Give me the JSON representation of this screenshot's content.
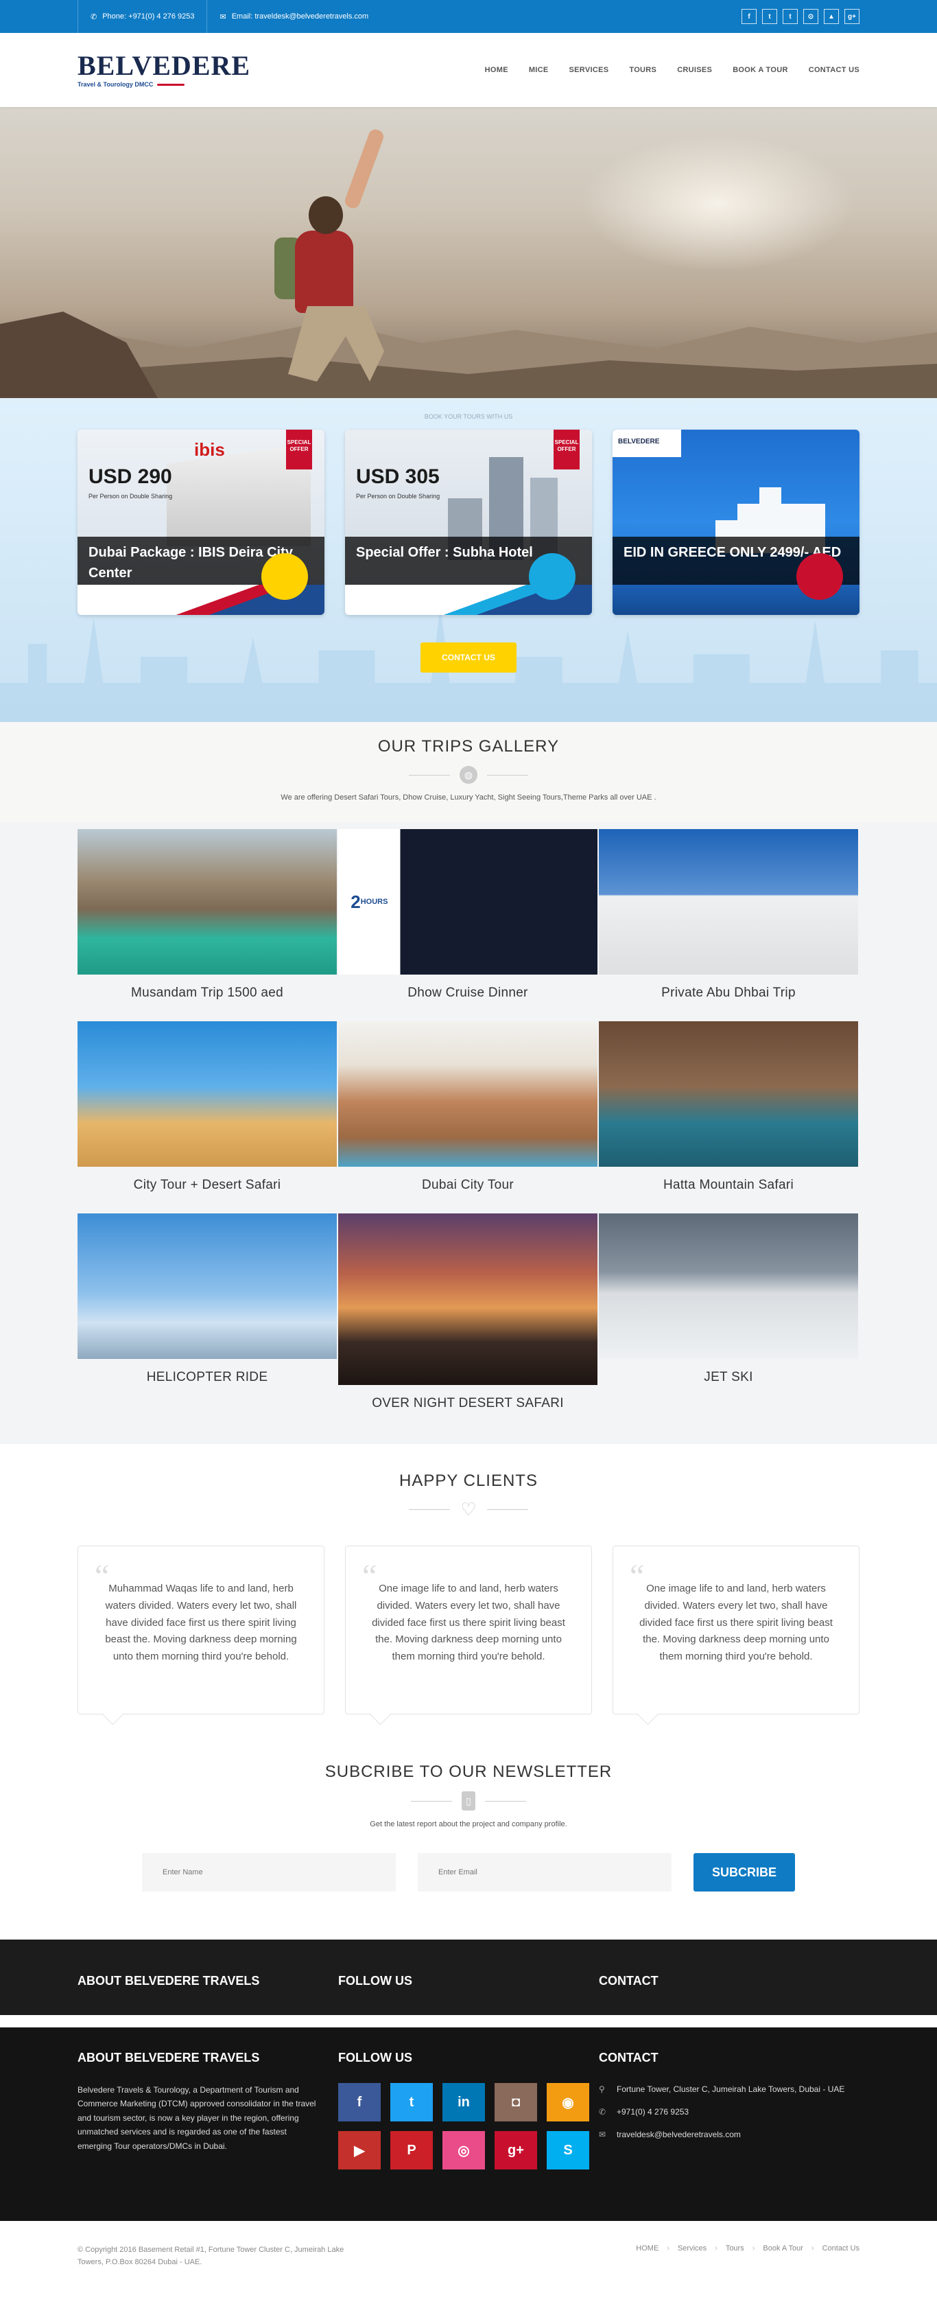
{
  "topbar": {
    "phone": "Phone: +971(0) 4 276 9253",
    "email": "Email: traveldesk@belvederetravels.com",
    "socials": [
      "f",
      "t",
      "t",
      "⊙",
      "▲",
      "g+"
    ]
  },
  "header": {
    "logo_name": "BELVEDERE",
    "logo_tag": "Travel & Tourology DMCC",
    "nav": [
      "HOME",
      "MICE",
      "SERVICES",
      "TOURS",
      "CRUISES",
      "BOOK A TOUR",
      "CONTACT US"
    ]
  },
  "offers": {
    "small_title": "BOOK YOUR TOURS WITH US",
    "cards": [
      {
        "price": "USD 290",
        "sub": "Per Person on Double Sharing",
        "badge": "SPECIAL OFFER",
        "caption": "Dubai Package : IBIS Deira City Center",
        "dot": "#ffd200"
      },
      {
        "price": "USD 305",
        "sub": "Per Person on Double Sharing",
        "badge": "SPECIAL OFFER",
        "caption": "Special Offer : Subha Hotel",
        "dot": "#19a9e1"
      },
      {
        "price": "",
        "sub": "",
        "badge": "",
        "caption": "EID IN GREECE ONLY 2499/- AED",
        "dot": "#c8102e"
      }
    ],
    "button": "CONTACT US"
  },
  "gallery": {
    "title": "OUR TRIPS GALLERY",
    "subtitle": "We are offering Desert Safari Tours, Dhow Cruise, Luxury Yacht, Sight Seeing Tours,Theme Parks all over UAE .",
    "items": [
      {
        "label": "Musandam Trip 1500 aed"
      },
      {
        "label": "Dhow Cruise Dinner"
      },
      {
        "label": "Private Abu Dhbai Trip"
      },
      {
        "label": "City Tour + Desert Safari"
      },
      {
        "label": "Dubai City Tour"
      },
      {
        "label": "Hatta Mountain Safari"
      },
      {
        "label": "HELICOPTER RIDE"
      },
      {
        "label": "OVER NIGHT DESERT SAFARI"
      },
      {
        "label": "JET SKI"
      }
    ]
  },
  "clients": {
    "title": "HAPPY CLIENTS",
    "testimonials": [
      "Muhammad Waqas life to and land, herb waters divided. Waters every let two, shall have divided face first us there spirit living beast the. Moving darkness deep morning unto them morning third you're behold.",
      "One image life to and land, herb waters divided. Waters every let two, shall have divided face first us there spirit living beast the. Moving darkness deep morning unto them morning third you're behold.",
      "One image life to and land, herb waters divided. Waters every let two, shall have divided face first us there spirit living beast the. Moving darkness deep morning unto them morning third you're behold."
    ]
  },
  "newsletter": {
    "title": "SUBCRIBE TO OUR NEWSLETTER",
    "subtitle": "Get the latest report about the project and company profile.",
    "name_placeholder": "Enter Name",
    "email_placeholder": "Enter Email",
    "button": "SUBCRIBE"
  },
  "footer": {
    "about_title": "ABOUT BELVEDERE TRAVELS",
    "follow_title": "FOLLOW US",
    "contact_title": "CONTACT",
    "about_text": "Belvedere Travels & Tourology, a Department of Tourism and Commerce Marketing (DTCM) approved consolidator in the travel and tourism sector, is now a key player in the region, offering unmatched services and is regarded as one of the fastest emerging Tour operators/DMCs in Dubai.",
    "social_buttons": [
      {
        "glyph": "f",
        "color": "#3b5998"
      },
      {
        "glyph": "t",
        "color": "#1da1f2"
      },
      {
        "glyph": "in",
        "color": "#0077b5"
      },
      {
        "glyph": "◘",
        "color": "#8a6a5a"
      },
      {
        "glyph": "◉",
        "color": "#f39c12"
      },
      {
        "glyph": "▶",
        "color": "#c4302b"
      },
      {
        "glyph": "P",
        "color": "#cb2027"
      },
      {
        "glyph": "◎",
        "color": "#ea4c89"
      },
      {
        "glyph": "g+",
        "color": "#c8102e"
      },
      {
        "glyph": "S",
        "color": "#00aff0"
      }
    ],
    "address": "Fortune Tower, Cluster C, Jumeirah Lake Towers, Dubai - UAE",
    "phone": "+971(0) 4 276 9253",
    "email": "traveldesk@belvederetravels.com"
  },
  "bottom": {
    "copyright": "© Copyright 2016 Basement Retail #1, Fortune Tower Cluster C, Jumeirah Lake Towers, P.O.Box 80264 Dubai - UAE.",
    "links": [
      "HOME",
      "Services",
      "Tours",
      "Book A Tour",
      "Contact Us"
    ]
  }
}
